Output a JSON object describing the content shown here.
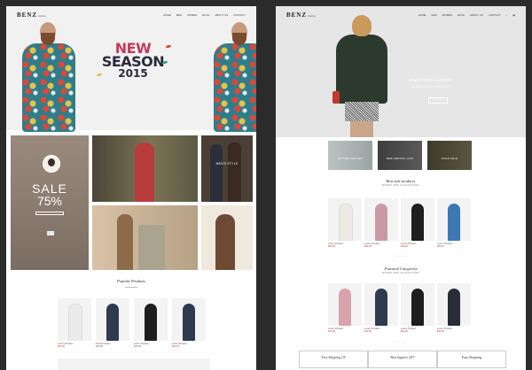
{
  "left": {
    "logo": "BENZ",
    "logo_sub": "fashion",
    "menu": [
      "HOME",
      "MEN",
      "WOMEN",
      "BLOG",
      "ABOUT US",
      "CONTACT"
    ],
    "hero": {
      "line1": "NEW",
      "line2": "SEASON",
      "line3": "2015"
    },
    "sale": {
      "label": "SALE",
      "percent": "75%"
    },
    "tiles": [
      "",
      "MEN'S STYLE",
      "",
      ""
    ],
    "popular_title": "Popular Products",
    "products": [
      {
        "name": "Lorem Product",
        "price": "$40.00"
      },
      {
        "name": "Product Demo",
        "price": "$40.00"
      },
      {
        "name": "Lorem Product",
        "price": "$40.00"
      },
      {
        "name": "Lorem Product",
        "price": "$40.00"
      }
    ]
  },
  "right": {
    "logo": "BENZ",
    "logo_sub": "fashion",
    "menu": [
      "HOME",
      "MEN",
      "WOMEN",
      "BLOG",
      "ABOUT US",
      "CONTACT"
    ],
    "hero": {
      "title": "Waxed Fabric Overshirt",
      "subtitle": "New Fashion Collection · Shop Online",
      "button": "SHOP NOW"
    },
    "categories": [
      "AUTUMN WINTER",
      "NEW ARRIVAL 2015",
      "HUGE SALE"
    ],
    "best_title": "Best sale products",
    "best_tabs": [
      "WOMEN",
      "MEN",
      "ACCESSORIES"
    ],
    "best_products": [
      {
        "name": "Lorem Product",
        "price": "$40.00"
      },
      {
        "name": "Lorem Product",
        "price": "$40.00"
      },
      {
        "name": "Lorem Product",
        "price": "$40.00"
      },
      {
        "name": "Lorem Product",
        "price": "$40.00"
      }
    ],
    "featured_title": "Featured Categories",
    "featured_tabs": [
      "WOMEN",
      "MEN",
      "ACCESSORIES"
    ],
    "featured_products": [
      {
        "name": "Lorem Product",
        "price": "$40.00"
      },
      {
        "name": "Lorem Product",
        "price": "$40.00"
      },
      {
        "name": "Lorem Product",
        "price": "$40.00"
      },
      {
        "name": "Lorem Product",
        "price": "$40.00"
      }
    ],
    "pager": "• • • •",
    "services": [
      "Free Shipping US",
      "Best Support 24/7",
      "Easy Shopping"
    ]
  },
  "colors": {
    "background": "#2b2b2b",
    "accent": "#c23a5b",
    "price": "#c0392b"
  }
}
